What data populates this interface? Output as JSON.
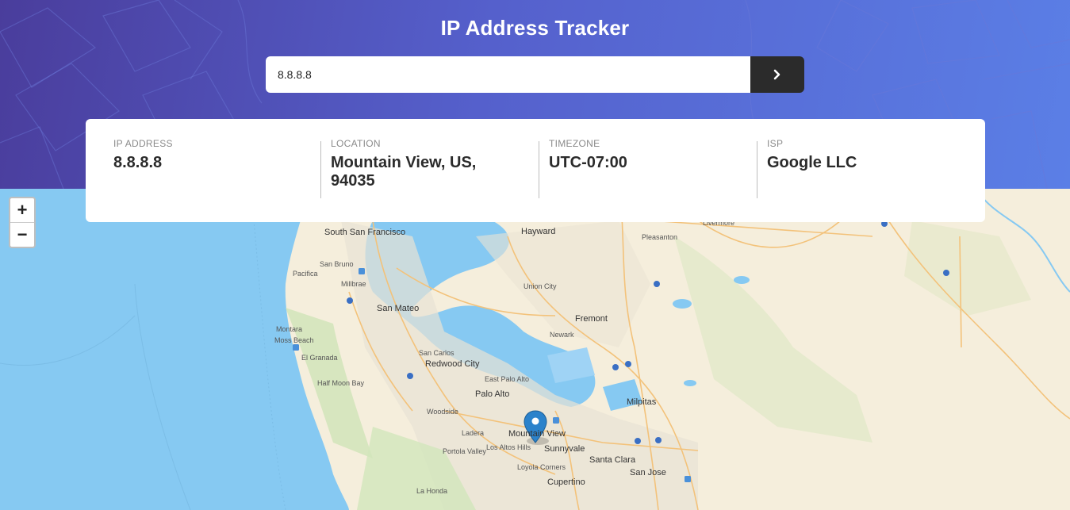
{
  "header": {
    "title": "IP Address Tracker",
    "gradient_colors": [
      "#4a3d9c",
      "#5560cc",
      "#5b7fe6"
    ]
  },
  "search": {
    "value": "8.8.8.8",
    "submit_icon": "chevron-right-icon",
    "button_color": "#2b2b2b"
  },
  "info": [
    {
      "label": "IP Address",
      "value": "8.8.8.8"
    },
    {
      "label": "Location",
      "value": "Mountain View, US, 94035"
    },
    {
      "label": "Timezone",
      "value": "UTC-07:00"
    },
    {
      "label": "ISP",
      "value": "Google LLC"
    }
  ],
  "map": {
    "zoom_in": "+",
    "zoom_out": "−",
    "marker_icon": "map-pin-icon",
    "water_color": "#86c9f2",
    "land_color": "#f5eedc",
    "labels": {
      "south_san_francisco": "South San Francisco",
      "san_bruno": "San Bruno",
      "pacifica": "Pacifica",
      "millbrae": "Millbrae",
      "san_mateo": "San Mateo",
      "montara": "Montara",
      "moss_beach": "Moss Beach",
      "el_granada": "El Granada",
      "half_moon_bay": "Half Moon Bay",
      "san_carlos": "San Carlos",
      "redwood_city": "Redwood City",
      "east_palo_alto": "East Palo Alto",
      "palo_alto": "Palo Alto",
      "woodside": "Woodside",
      "ladera": "Ladera",
      "portola_valley": "Portola Valley",
      "los_altos_hills": "Los Altos Hills",
      "mountain_view": "Mountain View",
      "sunnyvale": "Sunnyvale",
      "santa_clara": "Santa Clara",
      "cupertino": "Cupertino",
      "san_jose": "San Jose",
      "la_honda": "La Honda",
      "loyola_corners": "Loyola Corners",
      "hayward": "Hayward",
      "union_city": "Union City",
      "fremont": "Fremont",
      "newark": "Newark",
      "milpitas": "Milpitas",
      "pleasanton": "Pleasanton",
      "livermore": "Livermore"
    }
  }
}
